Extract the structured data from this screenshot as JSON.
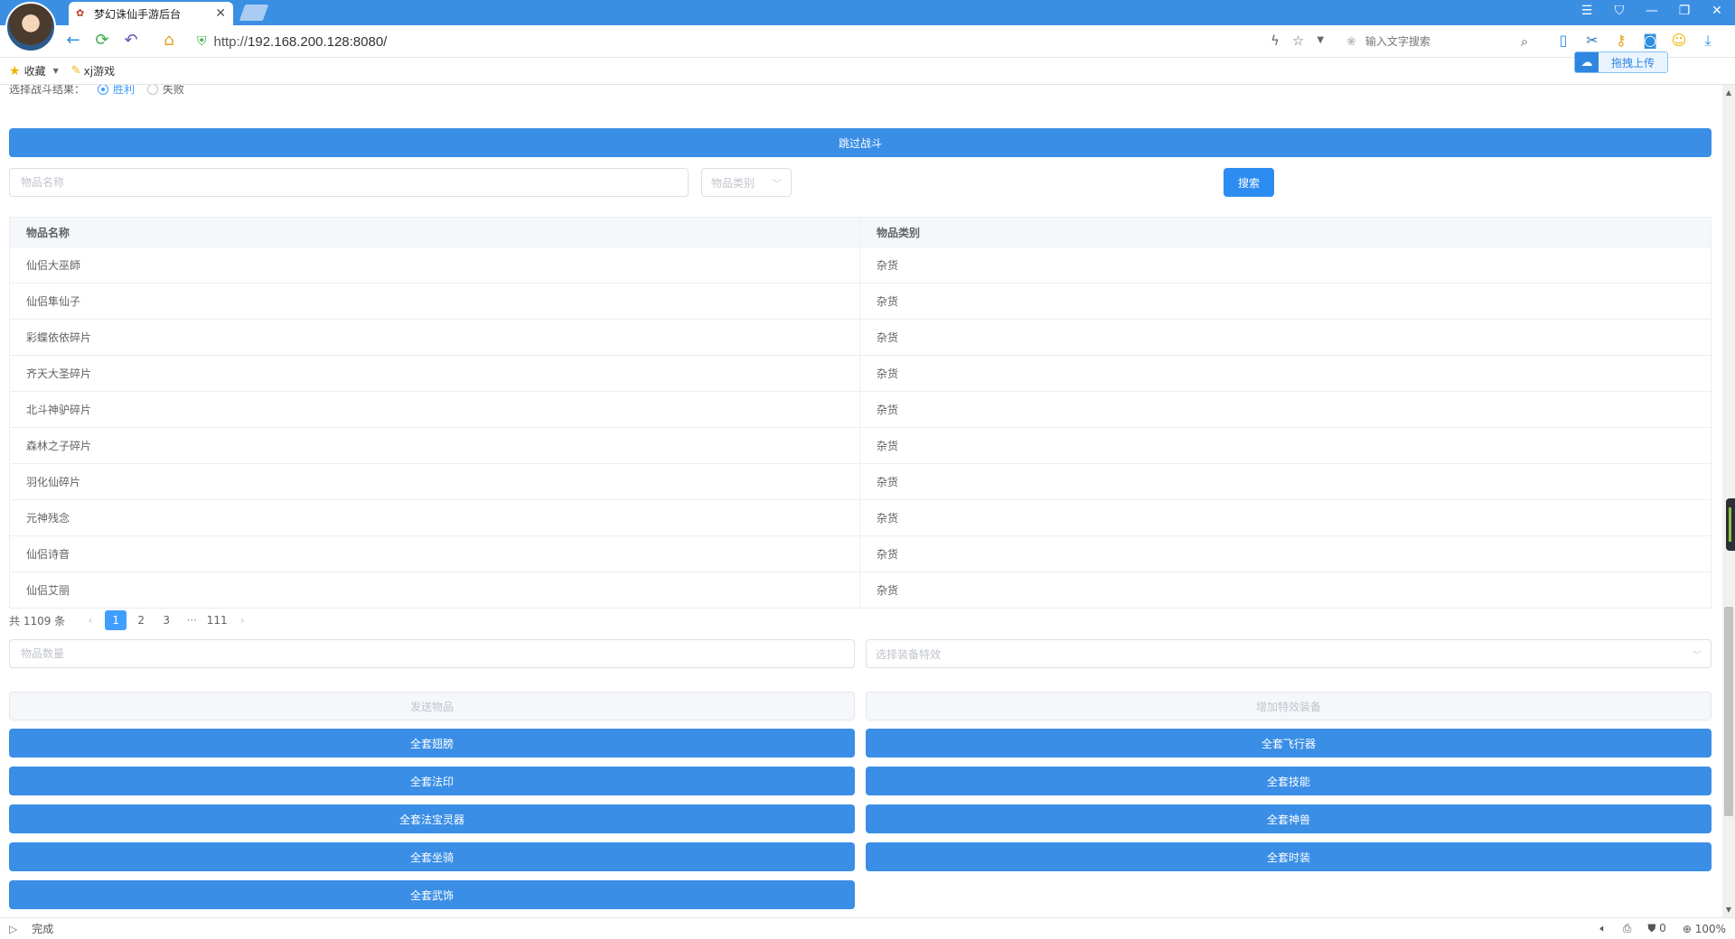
{
  "browser": {
    "tab_title": "梦幻诛仙手游后台",
    "url_proto": "http://",
    "url_host": "192.168.200.128:8080/",
    "search_placeholder": "输入文字搜索",
    "upload_label": "拖拽上传",
    "bookmarks": [
      {
        "label": "收藏"
      },
      {
        "label": "xj游戏"
      }
    ],
    "status_left": "完成",
    "status_zoom": "100%",
    "status_count": "0"
  },
  "battle": {
    "label": "选择战斗结果：",
    "options": [
      "胜利",
      "失败"
    ],
    "selected": "胜利",
    "skip_button": "跳过战斗"
  },
  "search": {
    "name_placeholder": "物品名称",
    "category_placeholder": "物品类别",
    "search_button": "搜索"
  },
  "table": {
    "columns": [
      "物品名称",
      "物品类别"
    ],
    "rows": [
      [
        "仙侣大巫師",
        "杂货"
      ],
      [
        "仙侣隼仙子",
        "杂货"
      ],
      [
        "彩蝶依依碎片",
        "杂货"
      ],
      [
        "齐天大圣碎片",
        "杂货"
      ],
      [
        "北斗神驴碎片",
        "杂货"
      ],
      [
        "森林之子碎片",
        "杂货"
      ],
      [
        "羽化仙碎片",
        "杂货"
      ],
      [
        "元神残念",
        "杂货"
      ],
      [
        "仙侣诗音",
        "杂货"
      ],
      [
        "仙侣艾丽",
        "杂货"
      ]
    ]
  },
  "pagination": {
    "total": "共 1109 条",
    "pages": [
      "1",
      "2",
      "3",
      "···",
      "111"
    ],
    "current": "1"
  },
  "send": {
    "quantity_placeholder": "物品数量",
    "effect_placeholder": "选择装备特效",
    "send_button": "发送物品",
    "add_effect_button": "增加特效装备"
  },
  "bulk_buttons": {
    "left": [
      "全套翅膀",
      "全套法印",
      "全套法宝灵器",
      "全套坐骑",
      "全套武饰"
    ],
    "right": [
      "全套飞行器",
      "全套技能",
      "全套神兽",
      "全套时装"
    ]
  }
}
